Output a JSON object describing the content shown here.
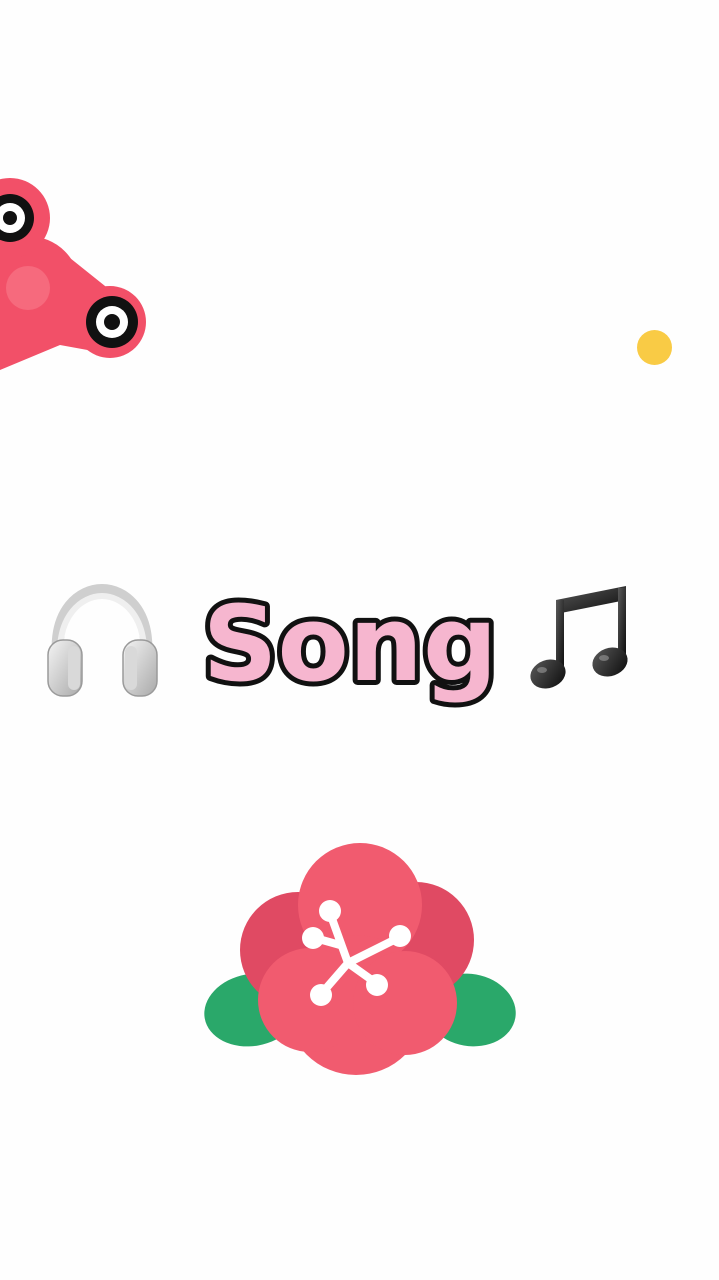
{
  "title": {
    "text": "Song"
  },
  "colors": {
    "background": "#fefefe",
    "title_fill": "#f6b6cf",
    "title_stroke": "#111111",
    "spinner": "#f25068",
    "dot": "#f9cb45",
    "flower_petal": "#f15b6f",
    "flower_petal_dark": "#e04a63",
    "flower_leaf": "#2aa86a",
    "stamen": "#ffffff"
  },
  "icons": {
    "left": "headphones-icon",
    "right": "music-note-icon",
    "top_left": "fidget-spinner-icon",
    "bottom": "flower-icon",
    "accent": "yellow-dot"
  }
}
